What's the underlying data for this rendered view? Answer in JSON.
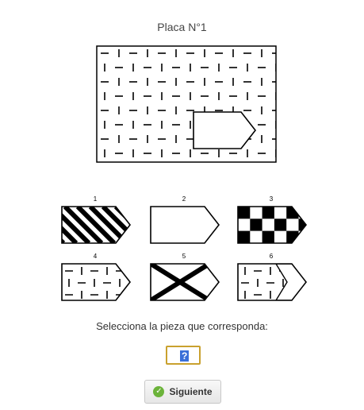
{
  "title": "Placa N°1",
  "plate": {
    "options": [
      {
        "number": "1",
        "pattern": "diagonal-stripes"
      },
      {
        "number": "2",
        "pattern": "blank"
      },
      {
        "number": "3",
        "pattern": "checkerboard"
      },
      {
        "number": "4",
        "pattern": "dash-pattern"
      },
      {
        "number": "5",
        "pattern": "x-cross"
      },
      {
        "number": "6",
        "pattern": "dash-pattern-offset"
      }
    ]
  },
  "prompt": "Selecciona la pieza que corresponda:",
  "answer": {
    "value": "?"
  },
  "next_button": {
    "label": "Siguiente",
    "icon": "check-icon"
  },
  "colors": {
    "accent_border": "#c9a12e",
    "selection": "#3a6fd8",
    "check": "#6bb33a"
  }
}
